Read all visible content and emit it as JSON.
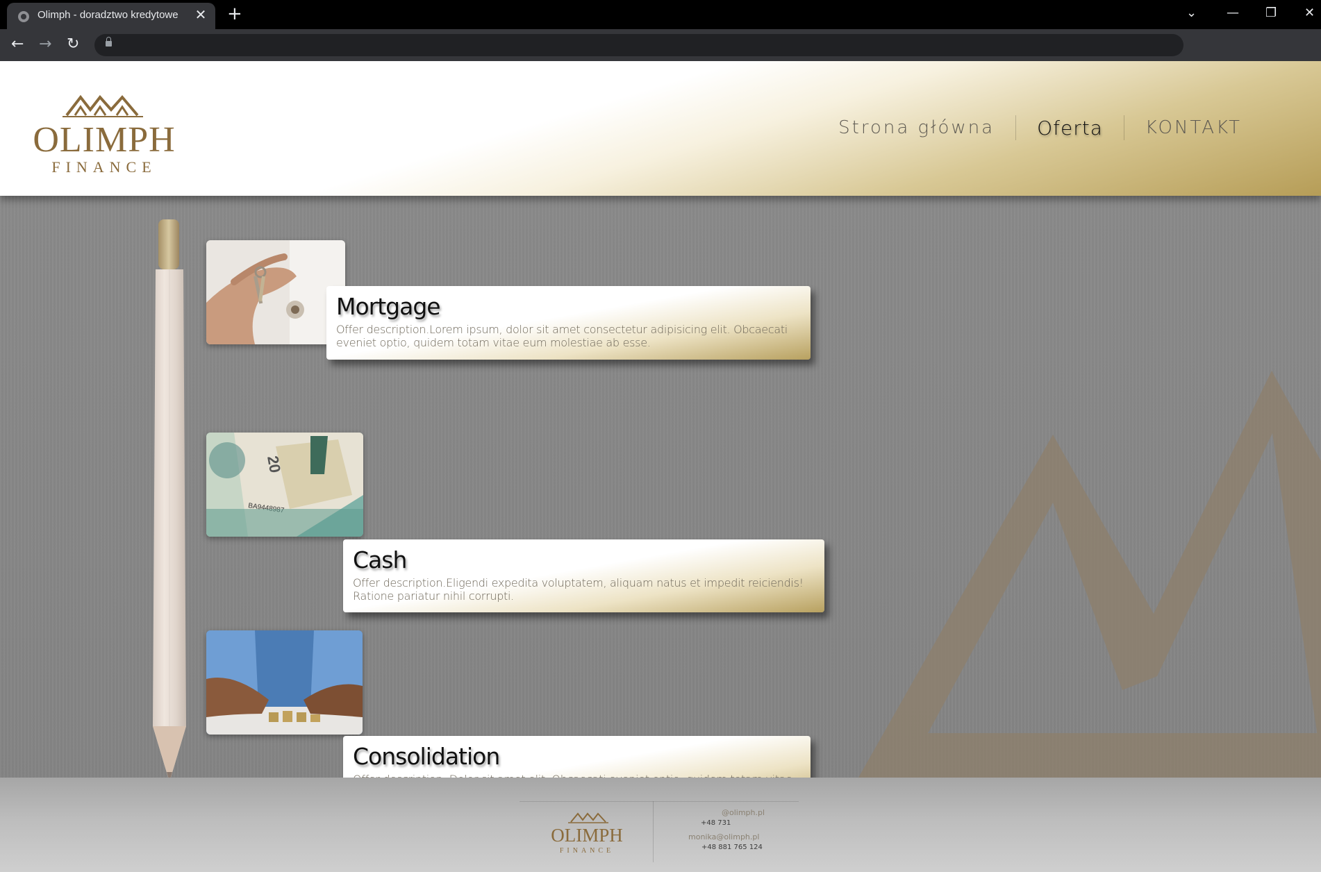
{
  "browser": {
    "tab_title": "Olimph - doradztwo kredytowe",
    "tab_close": "✕",
    "new_tab": "+",
    "back": "←",
    "forward": "→",
    "reload": "↻",
    "minimize": "—",
    "restore": "❐",
    "close": "✕",
    "tab_list": "⌄",
    "address": ""
  },
  "site": {
    "logo": {
      "name": "OLIMPH",
      "tagline": "FINANCE"
    },
    "nav": [
      {
        "label": "Strona główna",
        "active": false
      },
      {
        "label": "Oferta",
        "active": true
      },
      {
        "label": "KONTAKT",
        "active": false
      }
    ]
  },
  "offers": [
    {
      "title": "Mortgage",
      "description": "Offer description.Lorem ipsum, dolor sit amet consectetur adipisicing elit. Obcaecati eveniet optio, quidem totam vitae eum molestiae ab esse.",
      "image": "hand-holding-keys"
    },
    {
      "title": "Cash",
      "description": "Offer description.Eligendi expedita voluptatem, aliquam natus et impedit reiciendis! Ratione pariatur nihil corrupti.",
      "image": "polish-banknotes"
    },
    {
      "title": "Consolidation",
      "description": "Offer description. Dolor sit amet elit. Obcaecati eveniet optio, quidem totam vitae eum.",
      "image": "hands-stacking-coins"
    }
  ],
  "footer": {
    "logo": {
      "name": "OLIMPH",
      "tagline": "FINANCE"
    },
    "email_1": "@olimph.pl",
    "phone_1": "+48 731",
    "email_2": "monika@olimph.pl",
    "phone_2": "+48 881 765 124"
  },
  "colors": {
    "gold": "#8a6b3c",
    "gold_light": "#b69d57",
    "background": "#888888",
    "chrome": "#35363a"
  }
}
